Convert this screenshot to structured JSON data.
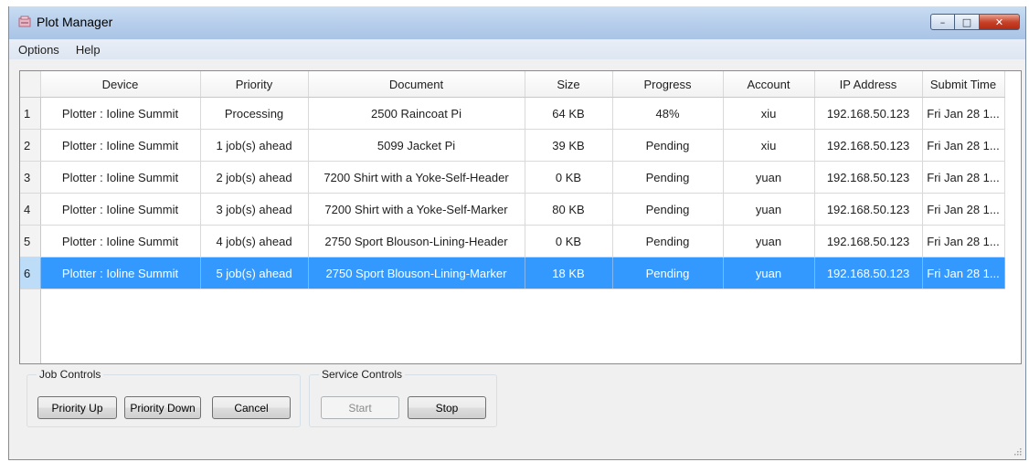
{
  "window": {
    "title": "Plot Manager",
    "buttons": {
      "minimize": "–",
      "maximize": "□",
      "close": "✕"
    }
  },
  "menu": [
    {
      "label": "Options"
    },
    {
      "label": "Help"
    }
  ],
  "table": {
    "columns": [
      "Device",
      "Priority",
      "Document",
      "Size",
      "Progress",
      "Account",
      "IP Address",
      "Submit Time"
    ],
    "rows": [
      {
        "num": "1",
        "device": "Plotter : Ioline Summit",
        "priority": "Processing",
        "document": "2500 Raincoat Pi",
        "size": "64 KB",
        "progress": "48%",
        "account": "xiu",
        "ip": "192.168.50.123",
        "time": "Fri Jan 28 1..."
      },
      {
        "num": "2",
        "device": "Plotter : Ioline Summit",
        "priority": "1 job(s) ahead",
        "document": "5099 Jacket Pi",
        "size": "39 KB",
        "progress": "Pending",
        "account": "xiu",
        "ip": "192.168.50.123",
        "time": "Fri Jan 28 1..."
      },
      {
        "num": "3",
        "device": "Plotter : Ioline Summit",
        "priority": "2 job(s) ahead",
        "document": "7200 Shirt with a Yoke-Self-Header",
        "size": "0 KB",
        "progress": "Pending",
        "account": "yuan",
        "ip": "192.168.50.123",
        "time": "Fri Jan 28 1..."
      },
      {
        "num": "4",
        "device": "Plotter : Ioline Summit",
        "priority": "3 job(s) ahead",
        "document": "7200 Shirt with a Yoke-Self-Marker",
        "size": "80 KB",
        "progress": "Pending",
        "account": "yuan",
        "ip": "192.168.50.123",
        "time": "Fri Jan 28 1..."
      },
      {
        "num": "5",
        "device": "Plotter : Ioline Summit",
        "priority": "4 job(s) ahead",
        "document": "2750 Sport Blouson-Lining-Header",
        "size": "0 KB",
        "progress": "Pending",
        "account": "yuan",
        "ip": "192.168.50.123",
        "time": "Fri Jan 28 1..."
      },
      {
        "num": "6",
        "device": "Plotter : Ioline Summit",
        "priority": "5 job(s) ahead",
        "document": "2750 Sport Blouson-Lining-Marker",
        "size": "18 KB",
        "progress": "Pending",
        "account": "yuan",
        "ip": "192.168.50.123",
        "time": "Fri Jan 28 1...",
        "selected": true
      }
    ]
  },
  "job_controls": {
    "label": "Job Controls",
    "priority_up": "Priority Up",
    "priority_down": "Priority Down",
    "cancel": "Cancel"
  },
  "service_controls": {
    "label": "Service Controls",
    "start": "Start",
    "start_enabled": false,
    "stop": "Stop"
  },
  "colors": {
    "selection": "#3399ff",
    "titlebar": "#b9d0ec",
    "close_button": "#c8432a"
  },
  "icons": {
    "app": "plot-manager-app-icon",
    "resize": "resize-grip-icon"
  }
}
